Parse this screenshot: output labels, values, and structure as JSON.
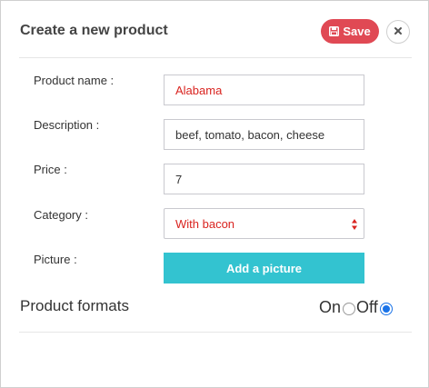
{
  "header": {
    "title": "Create a new product",
    "save_label": "Save"
  },
  "form": {
    "product_name": {
      "label": "Product name :",
      "value": "Alabama"
    },
    "description": {
      "label": "Description :",
      "value": "beef, tomato, bacon, cheese"
    },
    "price": {
      "label": "Price :",
      "value": "7"
    },
    "category": {
      "label": "Category :",
      "value": "With bacon"
    },
    "picture": {
      "label": "Picture :",
      "button_label": "Add a picture"
    }
  },
  "formats": {
    "label": "Product formats",
    "on_label": "On",
    "off_label": "Off",
    "selected": "Off"
  },
  "colors": {
    "save_button": "#e04954",
    "picture_button": "#33c3d0",
    "value_text": "#d9231f",
    "radio_checked": "#1a73e8"
  },
  "icons": {
    "save": "floppy-disk-icon",
    "close": "close-icon",
    "select": "select-arrows-icon"
  }
}
